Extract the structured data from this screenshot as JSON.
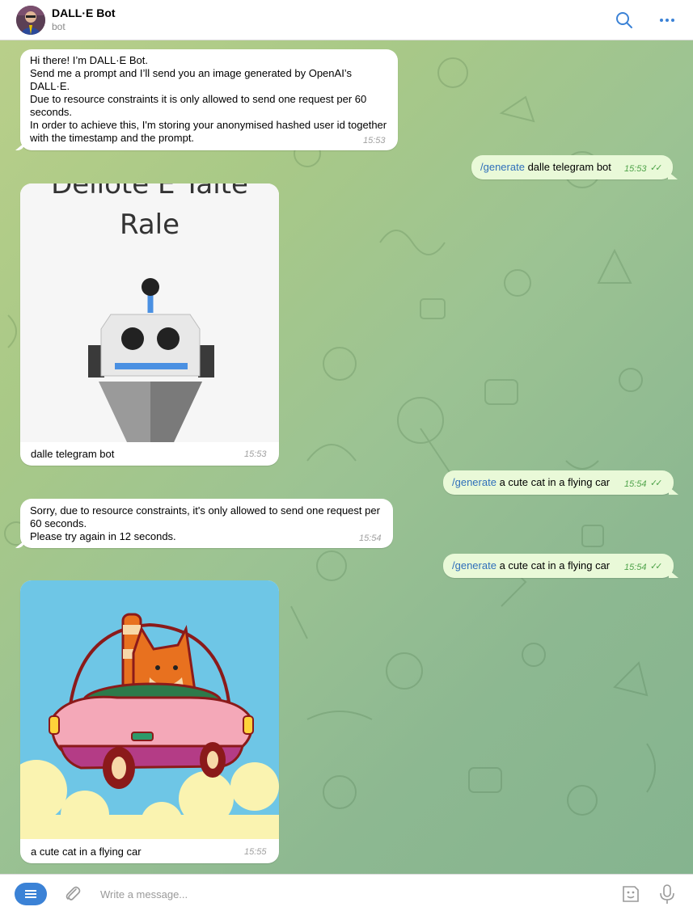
{
  "header": {
    "title": "DALL·E Bot",
    "status": "bot"
  },
  "messages": [
    {
      "id": "welcome",
      "direction": "incoming",
      "text": "Hi there! I’m DALL·E Bot.\nSend me a prompt and I’ll send you an image generated by OpenAI’s DALL·E.\nDue to resource constraints it is only allowed to send one request per 60 seconds.\nIn order to achieve this, I'm storing your anonymised hashed user id together with the timestamp and the prompt.",
      "time": "15:53"
    },
    {
      "id": "gen1",
      "direction": "outgoing",
      "command": "/generate",
      "text": "dalle telegram bot",
      "time": "15:53"
    },
    {
      "id": "img1",
      "direction": "incoming",
      "image_text_line1": "Dellote E Taite",
      "image_text_line2": "Rale",
      "caption": "dalle telegram bot",
      "time": "15:53"
    },
    {
      "id": "gen2",
      "direction": "outgoing",
      "command": "/generate",
      "text": "a cute cat in a flying car",
      "time": "15:54"
    },
    {
      "id": "limit",
      "direction": "incoming",
      "text": "Sorry, due to resource constraints, it's only allowed to send one request per 60 seconds.\nPlease try again in 12 seconds.",
      "time": "15:54"
    },
    {
      "id": "gen3",
      "direction": "outgoing",
      "command": "/generate",
      "text": "a cute cat in a flying car",
      "time": "15:54"
    },
    {
      "id": "img2",
      "direction": "incoming",
      "caption": "a cute cat in a flying car",
      "time": "15:55"
    }
  ],
  "composer": {
    "placeholder": "Write a message..."
  },
  "icons": {
    "search": "search-icon",
    "more": "more-icon",
    "menu": "menu-icon",
    "attach": "paperclip-icon",
    "sticker": "sticker-icon",
    "mic": "microphone-icon"
  },
  "colors": {
    "accent": "#3b82d6",
    "outgoing_bubble": "#e9f9d8",
    "incoming_bubble": "#ffffff",
    "read_check": "#4fa34a"
  }
}
